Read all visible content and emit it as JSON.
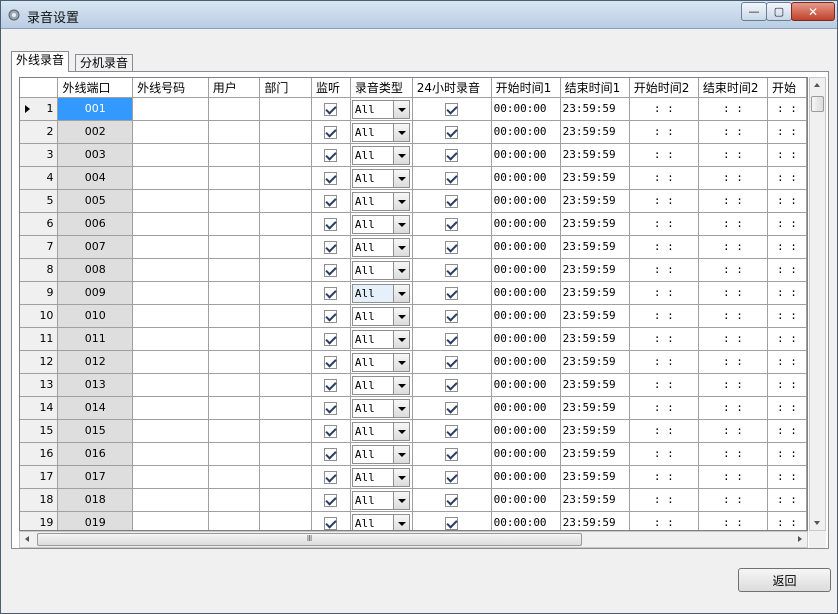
{
  "window": {
    "title": "录音设置",
    "min_glyph": "—",
    "max_glyph": "▢",
    "close_glyph": "✕"
  },
  "tabs": [
    {
      "label": "外线录音",
      "active": true
    },
    {
      "label": "分机录音",
      "active": false
    }
  ],
  "grid": {
    "columns": [
      "外线端口",
      "外线号码",
      "用户",
      "部门",
      "监听",
      "录音类型",
      "24小时录音",
      "开始时间1",
      "结束时间1",
      "开始时间2",
      "结束时间2",
      "开始"
    ],
    "empty_time": ":  :",
    "rows": [
      {
        "num": "1",
        "port": "001",
        "type": "All",
        "start1": "00:00:00",
        "end1": "23:59:59"
      },
      {
        "num": "2",
        "port": "002",
        "type": "All",
        "start1": "00:00:00",
        "end1": "23:59:59"
      },
      {
        "num": "3",
        "port": "003",
        "type": "All",
        "start1": "00:00:00",
        "end1": "23:59:59"
      },
      {
        "num": "4",
        "port": "004",
        "type": "All",
        "start1": "00:00:00",
        "end1": "23:59:59"
      },
      {
        "num": "5",
        "port": "005",
        "type": "All",
        "start1": "00:00:00",
        "end1": "23:59:59"
      },
      {
        "num": "6",
        "port": "006",
        "type": "All",
        "start1": "00:00:00",
        "end1": "23:59:59"
      },
      {
        "num": "7",
        "port": "007",
        "type": "All",
        "start1": "00:00:00",
        "end1": "23:59:59"
      },
      {
        "num": "8",
        "port": "008",
        "type": "All",
        "start1": "00:00:00",
        "end1": "23:59:59"
      },
      {
        "num": "9",
        "port": "009",
        "type": "All",
        "start1": "00:00:00",
        "end1": "23:59:59"
      },
      {
        "num": "10",
        "port": "010",
        "type": "All",
        "start1": "00:00:00",
        "end1": "23:59:59"
      },
      {
        "num": "11",
        "port": "011",
        "type": "All",
        "start1": "00:00:00",
        "end1": "23:59:59"
      },
      {
        "num": "12",
        "port": "012",
        "type": "All",
        "start1": "00:00:00",
        "end1": "23:59:59"
      },
      {
        "num": "13",
        "port": "013",
        "type": "All",
        "start1": "00:00:00",
        "end1": "23:59:59"
      },
      {
        "num": "14",
        "port": "014",
        "type": "All",
        "start1": "00:00:00",
        "end1": "23:59:59"
      },
      {
        "num": "15",
        "port": "015",
        "type": "All",
        "start1": "00:00:00",
        "end1": "23:59:59"
      },
      {
        "num": "16",
        "port": "016",
        "type": "All",
        "start1": "00:00:00",
        "end1": "23:59:59"
      },
      {
        "num": "17",
        "port": "017",
        "type": "All",
        "start1": "00:00:00",
        "end1": "23:59:59"
      },
      {
        "num": "18",
        "port": "018",
        "type": "All",
        "start1": "00:00:00",
        "end1": "23:59:59"
      },
      {
        "num": "19",
        "port": "019",
        "type": "All",
        "start1": "00:00:00",
        "end1": "23:59:59"
      }
    ]
  },
  "scrollbar": {
    "grip_glyph": "Ⅲ"
  },
  "footer": {
    "back_label": "返回"
  },
  "colors": {
    "selected_cell": "#3399ff",
    "port_cell": "#dedede"
  }
}
